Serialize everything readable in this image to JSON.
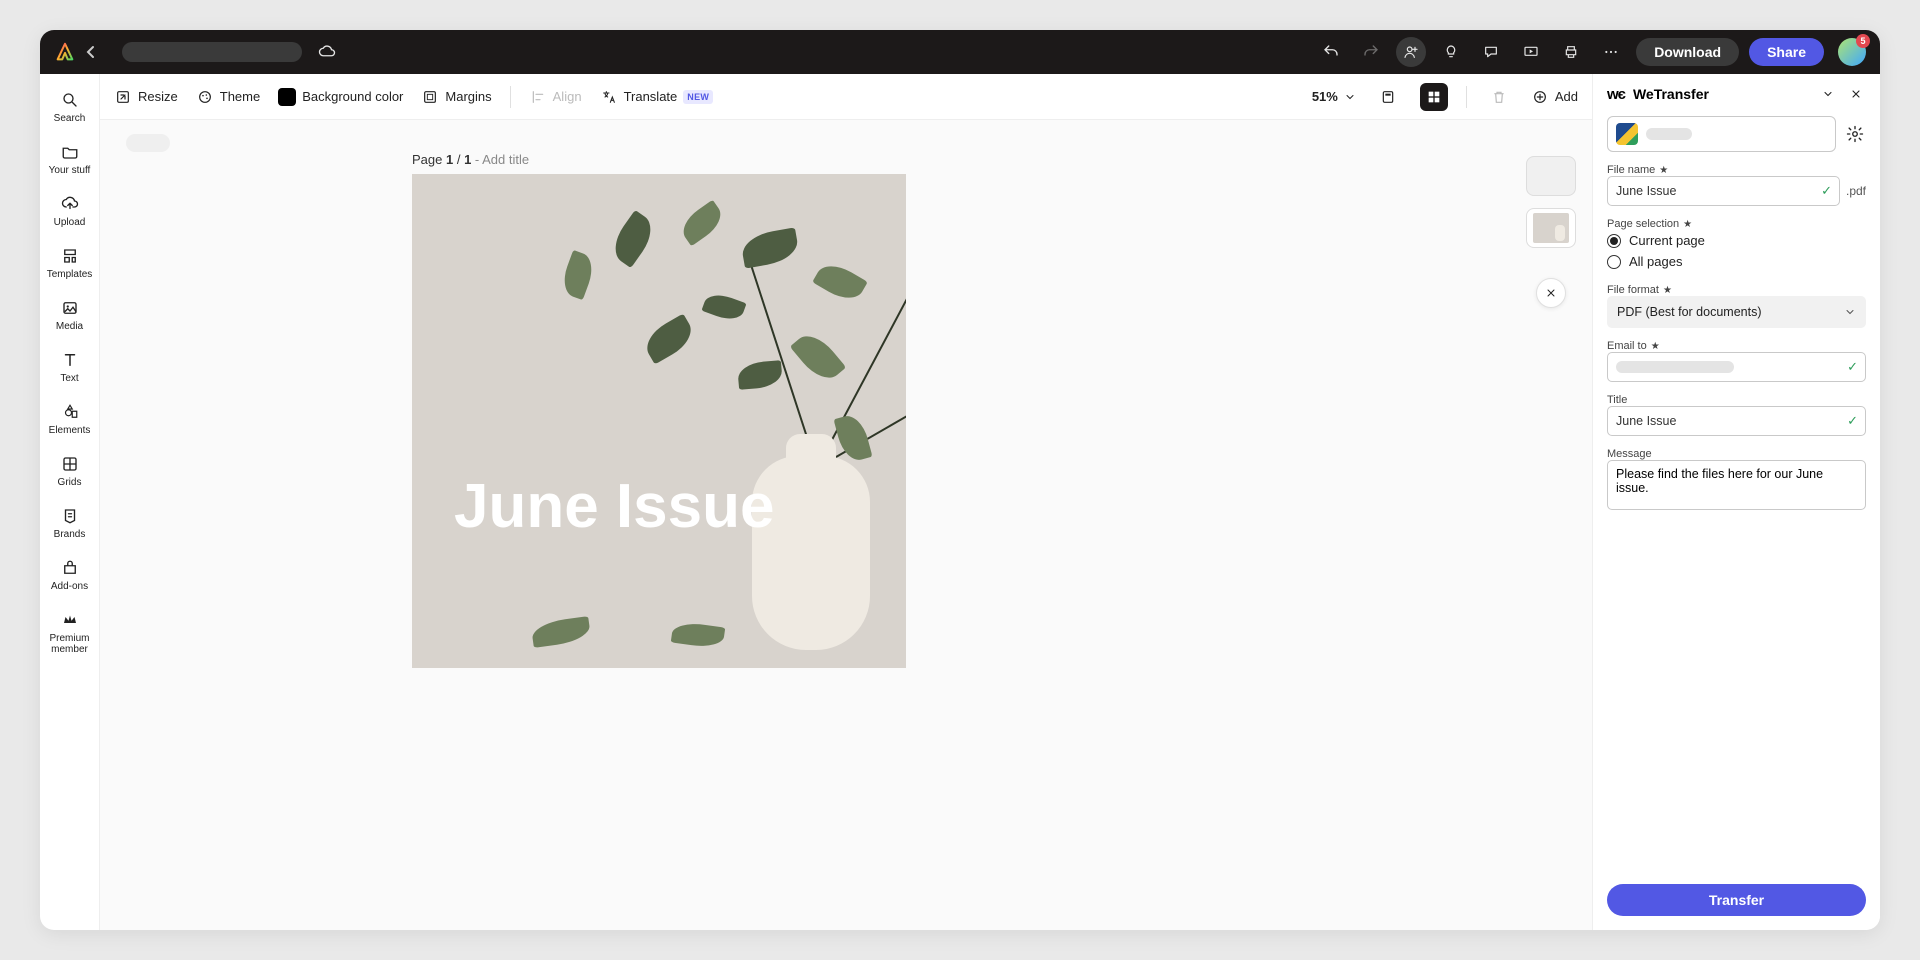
{
  "header": {
    "download_label": "Download",
    "share_label": "Share",
    "avatar_badge": "5"
  },
  "rail": {
    "items": [
      {
        "label": "Search"
      },
      {
        "label": "Your stuff"
      },
      {
        "label": "Upload"
      },
      {
        "label": "Templates"
      },
      {
        "label": "Media"
      },
      {
        "label": "Text"
      },
      {
        "label": "Elements"
      },
      {
        "label": "Grids"
      },
      {
        "label": "Brands"
      },
      {
        "label": "Add-ons"
      },
      {
        "label": "Premium member"
      }
    ]
  },
  "toolbar": {
    "resize": "Resize",
    "theme": "Theme",
    "bgcolor": "Background color",
    "margins": "Margins",
    "align": "Align",
    "translate": "Translate",
    "new_pill": "NEW",
    "zoom": "51%",
    "add": "Add"
  },
  "canvas": {
    "page_label_prefix": "Page ",
    "page_current": "1",
    "page_sep": " / ",
    "page_total": "1",
    "add_title": " - Add title",
    "artboard_title": "June Issue"
  },
  "panel": {
    "title": "WeTransfer",
    "file_name_label": "File name",
    "file_name_value": "June Issue",
    "file_ext": ".pdf",
    "page_selection_label": "Page selection",
    "radio_current": "Current page",
    "radio_all": "All pages",
    "file_format_label": "File format",
    "file_format_value": "PDF (Best for documents)",
    "email_to_label": "Email to",
    "title_label": "Title",
    "title_value": "June Issue",
    "message_label": "Message",
    "message_value": "Please find the files here for our June issue.",
    "transfer_label": "Transfer"
  }
}
